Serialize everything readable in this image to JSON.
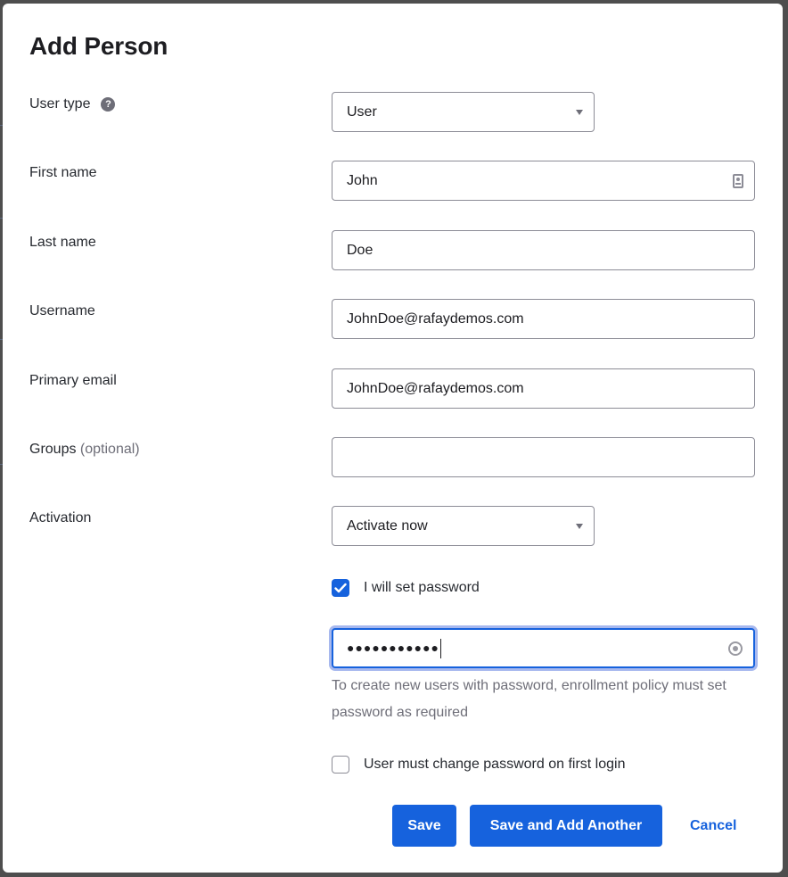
{
  "dialog": {
    "title": "Add Person"
  },
  "form": {
    "user_type": {
      "label": "User type",
      "help_icon": "question-circle-icon",
      "help_glyph": "?",
      "value": "User"
    },
    "first_name": {
      "label": "First name",
      "value": "John",
      "icon": "contact-card-icon"
    },
    "last_name": {
      "label": "Last name",
      "value": "Doe"
    },
    "username": {
      "label": "Username",
      "value": "JohnDoe@rafaydemos.com"
    },
    "primary_email": {
      "label": "Primary email",
      "value": "JohnDoe@rafaydemos.com"
    },
    "groups": {
      "label": "Groups",
      "optional": "(optional)",
      "value": ""
    },
    "activation": {
      "label": "Activation",
      "value": "Activate now"
    },
    "set_password": {
      "label": "I will set password",
      "checked": true
    },
    "password": {
      "masked_value": "●●●●●●●●●●●",
      "icon": "password-manager-icon"
    },
    "password_help": "To create new users with password, enrollment policy must set password as required",
    "change_on_login": {
      "label": "User must change password on first login",
      "checked": false
    }
  },
  "actions": {
    "save": "Save",
    "save_add_another": "Save and Add Another",
    "cancel": "Cancel"
  },
  "colors": {
    "primary": "#1662dd",
    "backdrop": "#4e4e4e",
    "focus_ring": "#a7b8ee"
  }
}
